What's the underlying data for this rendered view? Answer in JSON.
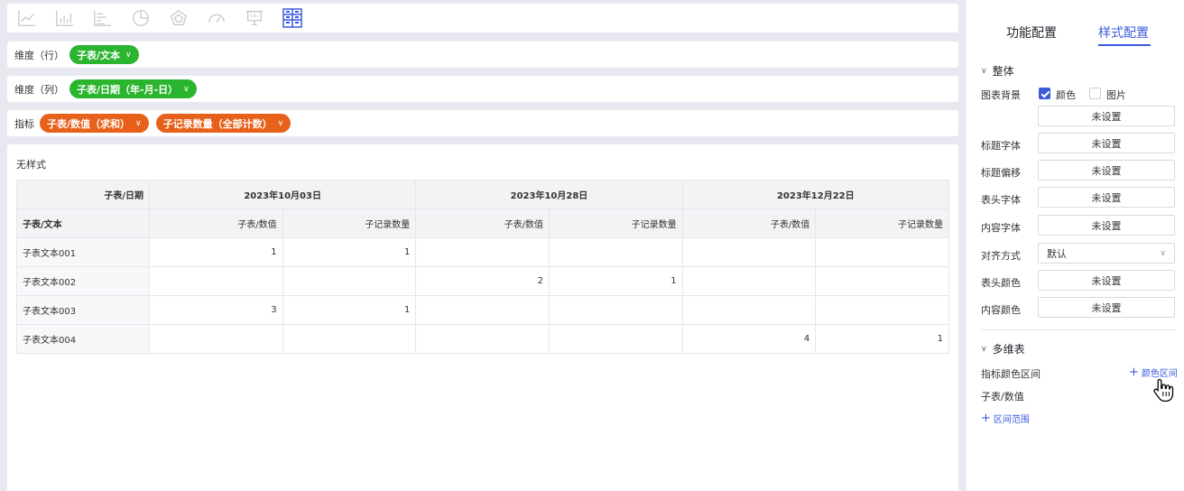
{
  "toolbar": {
    "icons": [
      "line-chart-icon",
      "bar-chart-icon",
      "horizontal-bar-chart-icon",
      "pie-chart-icon",
      "radar-chart-icon",
      "gauge-icon",
      "kanban-icon",
      "pivot-table-icon"
    ],
    "active_color": "#3b5bdb",
    "inactive_color": "#c4c7d0"
  },
  "rows_dimension": {
    "label": "维度（行）",
    "pills": [
      "子表/文本"
    ]
  },
  "cols_dimension": {
    "label": "维度（列）",
    "pills": [
      "子表/日期（年-月-日）"
    ]
  },
  "metrics": {
    "label": "指标",
    "pills": [
      "子表/数值（求和）",
      "子记录数量（全部计数）"
    ]
  },
  "chart": {
    "title": "无样式",
    "corner_col": "子表/日期",
    "corner_row": "子表/文本",
    "dates": [
      "2023年10月03日",
      "2023年10月28日",
      "2023年12月22日"
    ],
    "measures": [
      "子表/数值",
      "子记录数量"
    ],
    "rows": [
      {
        "label": "子表文本001",
        "cells": [
          "1",
          "1",
          "",
          "",
          "",
          ""
        ]
      },
      {
        "label": "子表文本002",
        "cells": [
          "",
          "",
          "2",
          "1",
          "",
          ""
        ]
      },
      {
        "label": "子表文本003",
        "cells": [
          "3",
          "1",
          "",
          "",
          "",
          ""
        ]
      },
      {
        "label": "子表文本004",
        "cells": [
          "",
          "",
          "",
          "",
          "4",
          "1"
        ]
      }
    ]
  },
  "panel": {
    "tabs": [
      "功能配置",
      "样式配置"
    ],
    "active_tab": "样式配置",
    "section_overall": "整体",
    "chart_bg_label": "图表背景",
    "bg_color_label": "颜色",
    "bg_image_label": "图片",
    "unset": "未设置",
    "title_font_label": "标题字体",
    "title_offset_label": "标题偏移",
    "header_font_label": "表头字体",
    "content_font_label": "内容字体",
    "align_label": "对齐方式",
    "align_value": "默认",
    "header_color_label": "表头颜色",
    "content_color_label": "内容颜色",
    "section_multi": "多维表",
    "metric_color_range_label": "指标颜色区间",
    "add_color_range": "颜色区间",
    "metric_field": "子表/数值",
    "add_range": "区间范围"
  },
  "colors": {
    "green_pill": "#2bb52f",
    "orange_pill": "#e8611a",
    "accent": "#3b5bdb"
  }
}
